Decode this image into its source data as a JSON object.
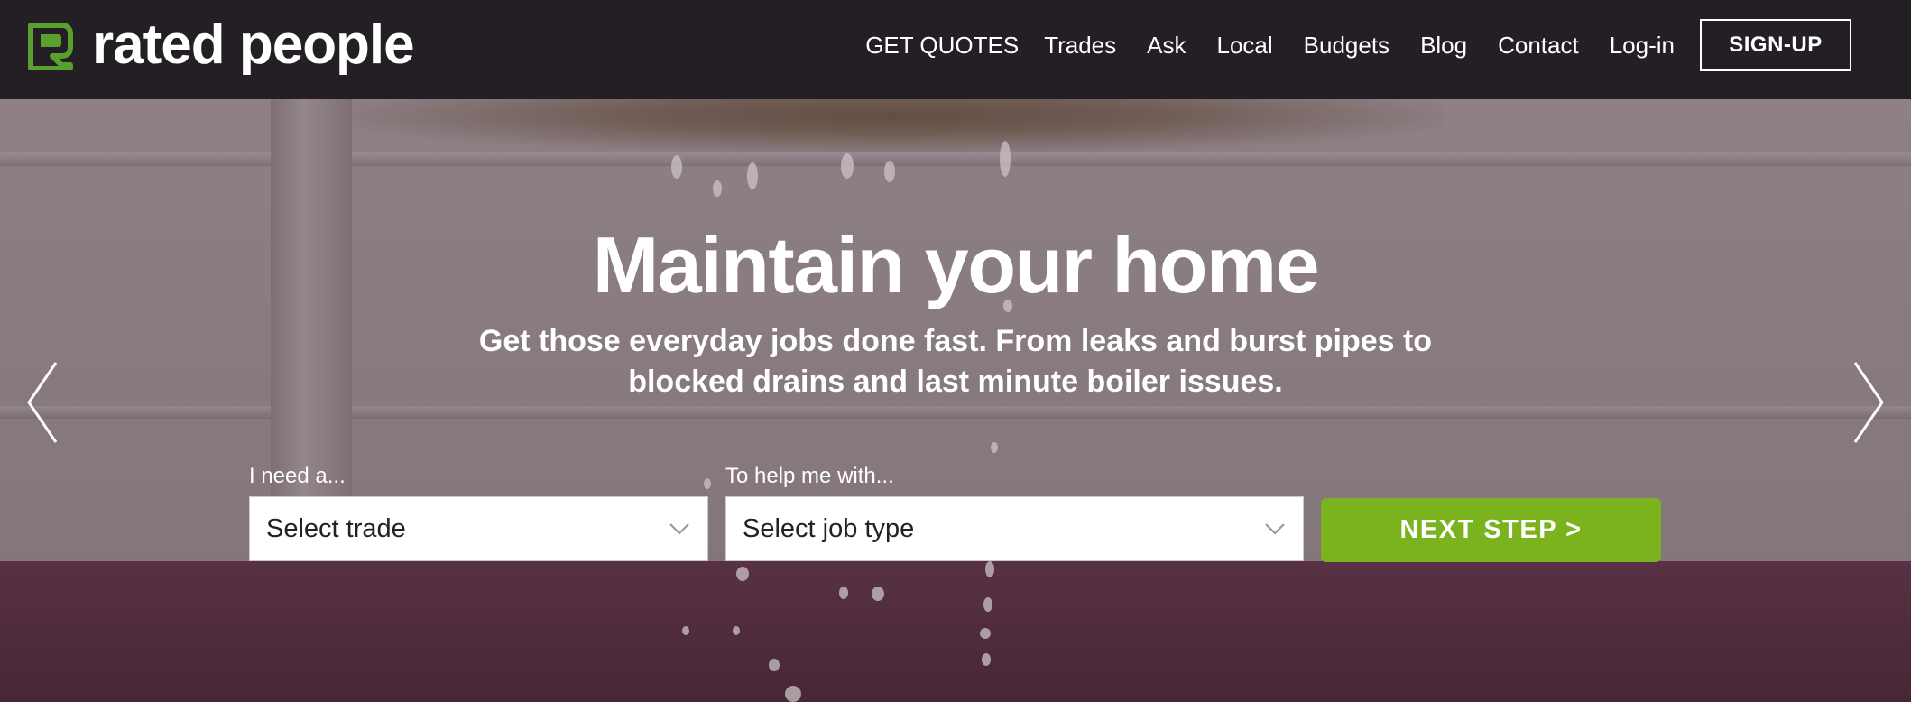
{
  "header": {
    "logo_text": "rated people",
    "nav": [
      {
        "label": "GET QUOTES"
      },
      {
        "label": "Trades"
      },
      {
        "label": "Ask"
      },
      {
        "label": "Local"
      },
      {
        "label": "Budgets"
      },
      {
        "label": "Blog"
      },
      {
        "label": "Contact"
      },
      {
        "label": "Log-in"
      }
    ],
    "signup_label": "SIGN-UP"
  },
  "hero": {
    "headline": "Maintain your home",
    "subtitle": "Get those everyday jobs done fast. From leaks and burst pipes to blocked drains and last minute boiler issues."
  },
  "form": {
    "trade_label": "I need a...",
    "trade_value": "Select trade",
    "job_label": "To help me with...",
    "job_value": "Select job type",
    "next_label": "NEXT STEP >"
  },
  "colors": {
    "header_bg": "#231f25",
    "brand_green": "#7bb31f",
    "logo_green": "#5aa02c",
    "text_white": "#ffffff"
  },
  "icons": {
    "logo_mark": "rated-people-r-icon",
    "prev": "chevron-left-icon",
    "next": "chevron-right-icon",
    "dropdown": "chevron-down-icon"
  }
}
